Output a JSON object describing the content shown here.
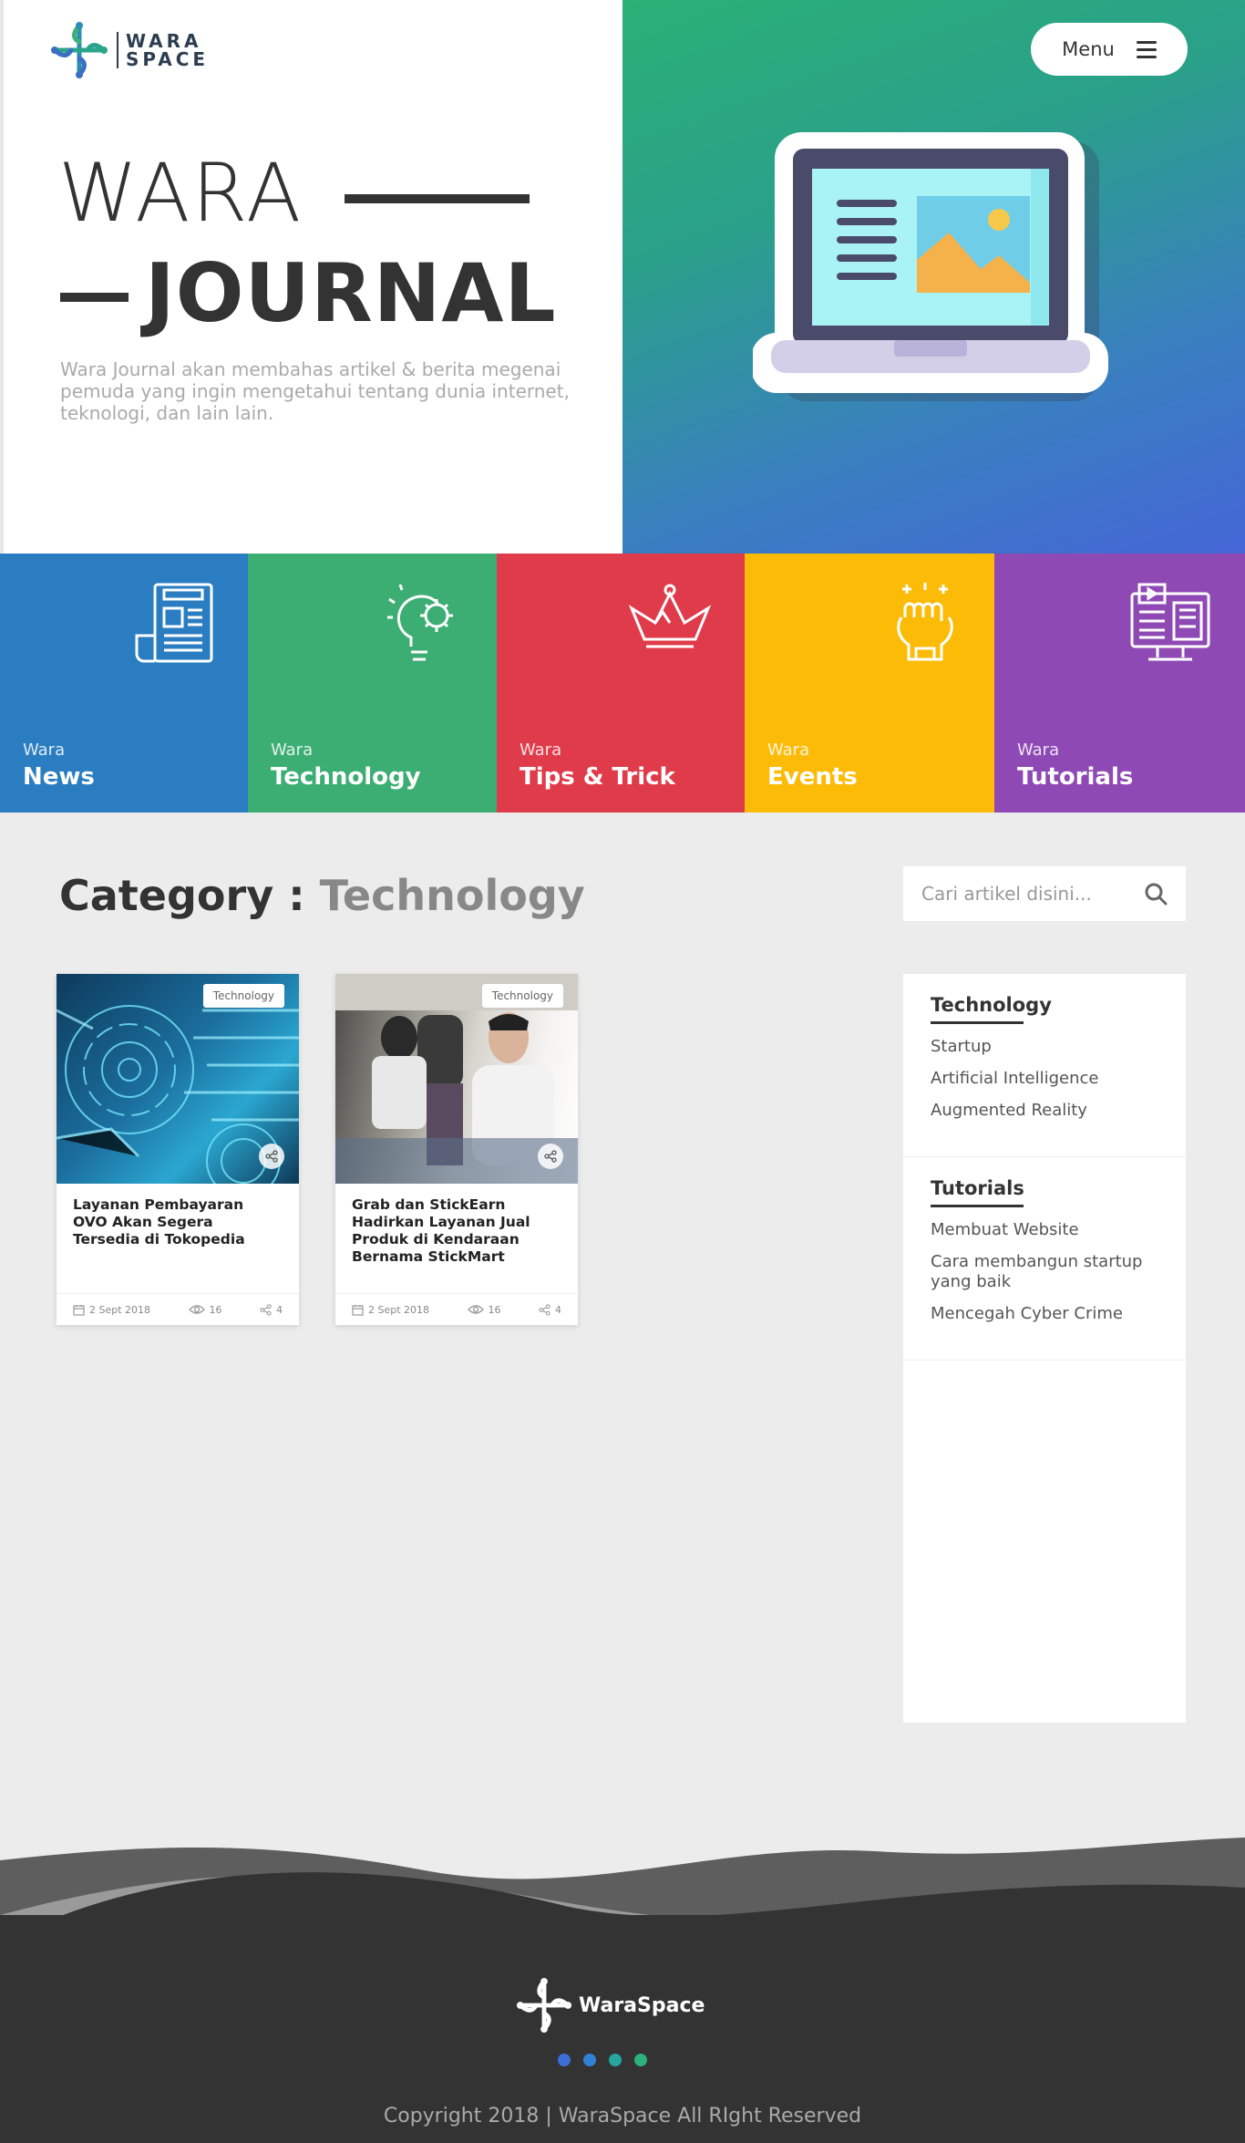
{
  "brand": {
    "line1": "WARA",
    "line2": "SPACE",
    "footer_name": "WaraSpace"
  },
  "menu": {
    "label": "Menu"
  },
  "hero": {
    "title_light": "WARA",
    "title_bold": "JOURNAL",
    "description": "Wara Journal akan membahas artikel & berita megenai pemuda yang ingin mengetahui tentang dunia internet, teknologi, dan lain lain."
  },
  "tiles": [
    {
      "sub": "Wara",
      "name": "News",
      "color": "#2a7dc1",
      "icon": "newspaper-icon"
    },
    {
      "sub": "Wara",
      "name": "Technology",
      "color": "#3cae74",
      "icon": "lightbulb-gear-icon"
    },
    {
      "sub": "Wara",
      "name": "Tips & Trick",
      "color": "#e03b4a",
      "icon": "crown-icon"
    },
    {
      "sub": "Wara",
      "name": "Events",
      "color": "#fbbb07",
      "icon": "fist-icon"
    },
    {
      "sub": "Wara",
      "name": "Tutorials",
      "color": "#8e49b5",
      "icon": "computer-icon"
    }
  ],
  "category": {
    "label": "Category :",
    "value": "Technology"
  },
  "search": {
    "placeholder": "Cari artikel disini..."
  },
  "articles": [
    {
      "tag": "Technology",
      "title": "Layanan Pembayaran OVO Akan Segera Tersedia di Tokopedia",
      "date": "2 Sept 2018",
      "views": "16",
      "shares": "4"
    },
    {
      "tag": "Technology",
      "title": "Grab dan StickEarn Hadirkan Layanan Jual Produk di Kendaraan Bernama StickMart",
      "date": "2 Sept 2018",
      "views": "16",
      "shares": "4"
    }
  ],
  "sidebar": {
    "sections": [
      {
        "title": "Technology",
        "links": [
          "Startup",
          "Artificial Intelligence",
          "Augmented Reality"
        ]
      },
      {
        "title": "Tutorials",
        "links": [
          "Membuat Website",
          "Cara membangun startup yang baik",
          "Mencegah Cyber Crime"
        ]
      }
    ]
  },
  "footer": {
    "copyright": "Copyright 2018 | WaraSpace All RIght Reserved",
    "dot_colors": [
      "#3b6fd6",
      "#2f82d6",
      "#25a6a0",
      "#2db07a"
    ]
  }
}
